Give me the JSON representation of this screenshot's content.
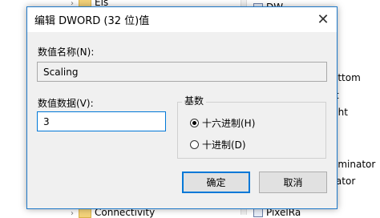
{
  "background": {
    "tree_items": [
      "Els",
      "Connectivity"
    ],
    "right_items": [
      "DW",
      "ottom",
      "ft",
      "ght",
      "p",
      "ominator",
      "rator",
      "PixelRa"
    ]
  },
  "dialog": {
    "title": "编辑 DWORD (32 位)值",
    "close_glyph": "✕",
    "name_label": "数值名称(N):",
    "name_value": "Scaling",
    "data_label": "数值数据(V):",
    "data_value": "3",
    "base_label": "基数",
    "radio_hex": "十六进制(H)",
    "radio_dec": "十进制(D)",
    "selected_base": "hex",
    "ok_label": "确定",
    "cancel_label": "取消"
  },
  "colors": {
    "accent": "#0078d7",
    "dialog_bg": "#f0f0f0"
  }
}
